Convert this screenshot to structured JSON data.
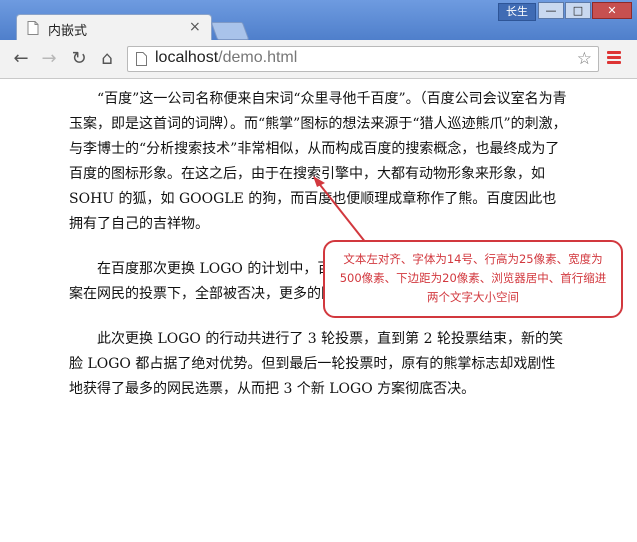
{
  "browser": {
    "tab_title": "内嵌式",
    "tab_close": "×",
    "user_badge": "长生",
    "url_host": "localhost",
    "url_path": "/demo.html"
  },
  "article": {
    "paragraphs": [
      "“百度”这一公司名称便来自宋词“众里寻他千百度”。（百度公司会议室名为青玉案，即是这首词的词牌）。而“熊掌”图标的想法来源于“猎人巡迹熊爪”的刺激，与李博士的“分析搜索技术”非常相似，从而构成百度的搜索概念，也最终成为了百度的图标形象。在这之后，由于在搜索引擎中，大都有动物形象来形象，如 SOHU 的狐，如 GOOGLE 的狗，而百度也便顺理成章称作了熊。百度因此也拥有了自己的吉祥物。",
      "在百度那次更换 LOGO 的计划中，百度的用户建议的5个新 LOGO 设计方案在网民的投票下，全部被否决，更多的网民将选票投给了原有的熊掌标志。",
      "此次更换 LOGO 的行动共进行了 3 轮投票，直到第 2 轮投票结束，新的笑脸 LOGO 都占据了绝对优势。但到最后一轮投票时，原有的熊掌标志却戏剧性地获得了最多的网民选票，从而把 3 个新 LOGO 方案彻底否决。"
    ]
  },
  "annotation": {
    "text": "文本左对齐、字体为14号、行高为25像素、宽度为500像素、下边距为20像素、浏览器居中、首行缩进两个文字大小空间",
    "color": "#d2383e"
  }
}
